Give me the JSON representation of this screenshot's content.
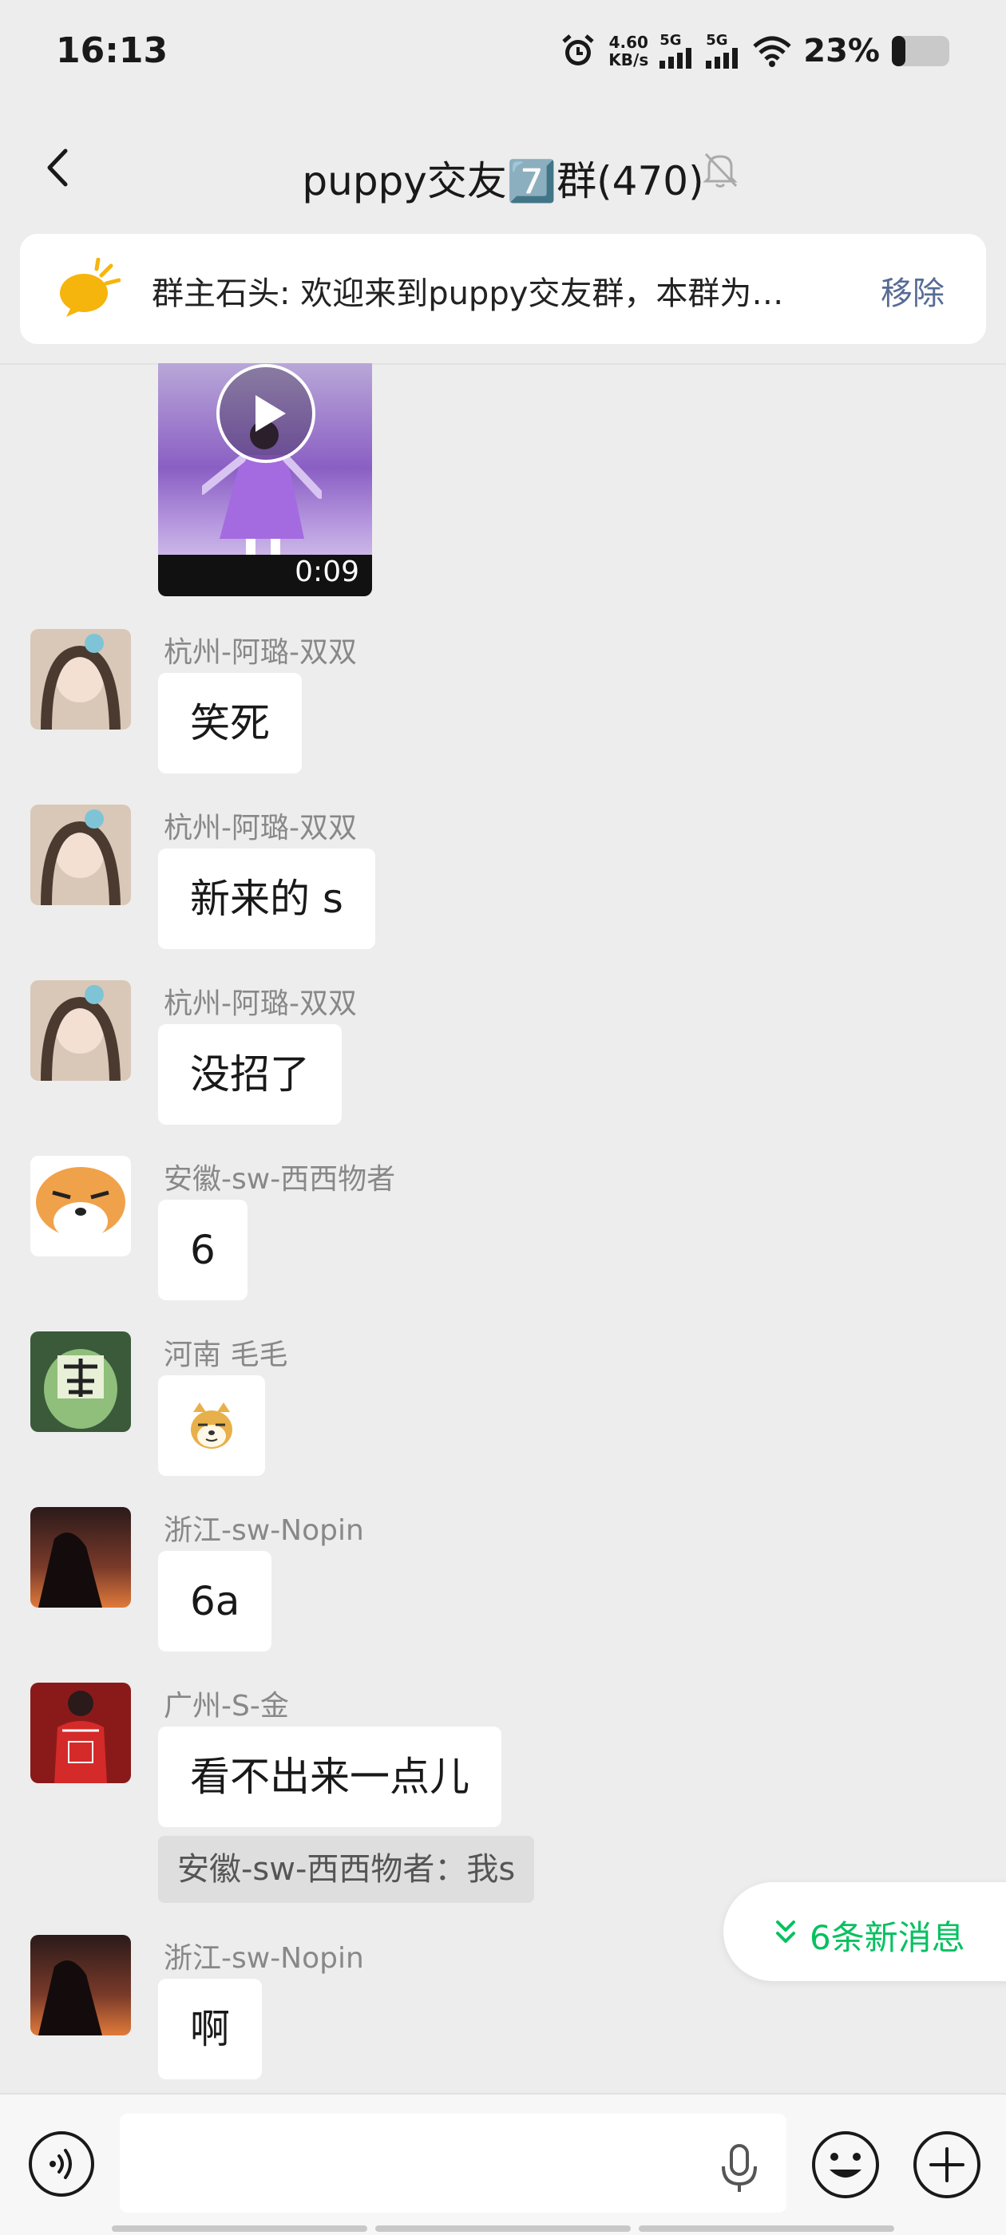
{
  "status_bar": {
    "time": "16:13",
    "net_speed_value": "4.60",
    "net_speed_unit": "KB/s",
    "sim1_label": "5G",
    "sim2_label": "5G",
    "battery": "23%",
    "icons": [
      "alarm-icon",
      "signal-icon",
      "signal-icon",
      "wifi-icon",
      "battery-icon"
    ]
  },
  "header": {
    "title": "puppy交友7️⃣群(470)",
    "icons": [
      "back-icon",
      "mute-bell-icon"
    ]
  },
  "pinned": {
    "text": "群主石头: 欢迎来到puppy交友群，本群为…",
    "remove_label": "移除",
    "icon": "speaker-bubble-icon"
  },
  "video": {
    "duration": "0:09",
    "icon": "play-icon"
  },
  "messages": [
    {
      "sender": "杭州-阿璐-双双",
      "text": "笑死"
    },
    {
      "sender": "杭州-阿璐-双双",
      "text": "新来的 s"
    },
    {
      "sender": "杭州-阿璐-双双",
      "text": "没招了"
    },
    {
      "sender": "安徽-sw-西西物者",
      "text": "6"
    },
    {
      "sender": "河南   毛毛",
      "text": "",
      "emoji": "doge-emoji-icon"
    },
    {
      "sender": "浙江-sw-Nopin",
      "text": "6a"
    },
    {
      "sender": "广州-S-金",
      "text": "看不出来一点儿",
      "quote": "安徽-sw-西西物者：我s"
    },
    {
      "sender": "浙江-sw-Nopin",
      "text": "啊"
    }
  ],
  "new_messages": {
    "label": "6条新消息",
    "icon": "double-chevron-down-icon"
  },
  "input_bar": {
    "placeholder": "",
    "icons": [
      "voice-icon",
      "mic-icon",
      "emoji-icon",
      "plus-icon"
    ]
  },
  "colors": {
    "background": "#ededed",
    "link": "#576b95",
    "accent_green": "#07c160",
    "bubble": "#ffffff"
  }
}
